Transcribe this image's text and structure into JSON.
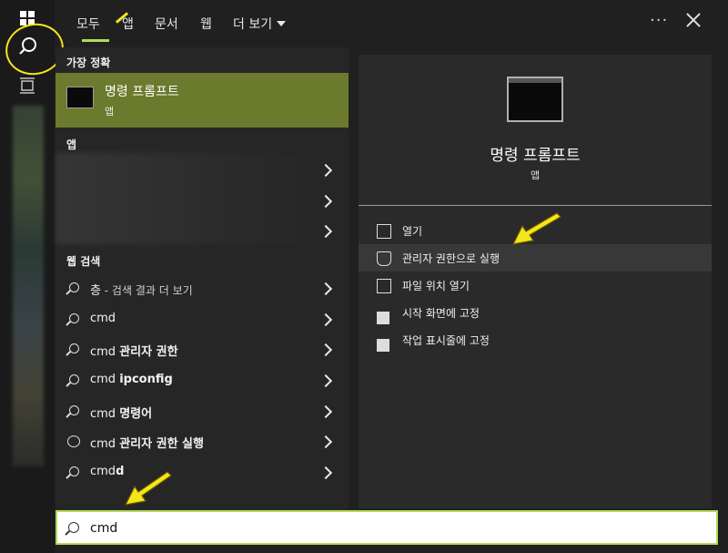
{
  "tabs": [
    {
      "label": "모두"
    },
    {
      "label": "앱"
    },
    {
      "label": "문서"
    },
    {
      "label": "웹"
    },
    {
      "label": "더 보기"
    }
  ],
  "more_icon": "ellipsis-icon",
  "close_icon": "close-icon",
  "best_match": {
    "section_label": "가장 정확",
    "title": "명령 프롬프트",
    "subtitle": "앱"
  },
  "apps_section_label": "앱",
  "web_section_label": "웹 검색",
  "web_results": [
    {
      "bold": "",
      "normal": "",
      "prefix": "층",
      "suffix": " - 검색 결과 더 보기",
      "icon": "search-icon"
    },
    {
      "prefix": "cmd",
      "suffix": "",
      "icon": "search-icon"
    },
    {
      "prefix": "cmd ",
      "suffix": "관리자 권한",
      "icon": "search-icon"
    },
    {
      "prefix": "cmd ",
      "suffix": "ipconfig",
      "icon": "search-icon"
    },
    {
      "prefix": "cmd ",
      "suffix": "명령어",
      "icon": "search-icon"
    },
    {
      "prefix": "cmd ",
      "suffix": "관리자 권한 실행",
      "icon": "chat-icon"
    },
    {
      "prefix": "cmd",
      "suffix": "d",
      "icon": "search-icon"
    }
  ],
  "detail": {
    "title": "명령 프롬프트",
    "subtitle": "앱",
    "actions": [
      {
        "label": "열기",
        "icon": "open-icon"
      },
      {
        "label": "관리자 권한으로 실행",
        "icon": "shield-icon"
      },
      {
        "label": "파일 위치 열기",
        "icon": "folder-icon"
      },
      {
        "label": "시작 화면에 고정",
        "icon": "pin-icon"
      },
      {
        "label": "작업 표시줄에 고정",
        "icon": "pin-icon"
      }
    ]
  },
  "search": {
    "value": "cmd"
  },
  "colors": {
    "accent": "#b4d85a",
    "highlight": "#6b7a2d",
    "annotation": "#f5e61a"
  }
}
